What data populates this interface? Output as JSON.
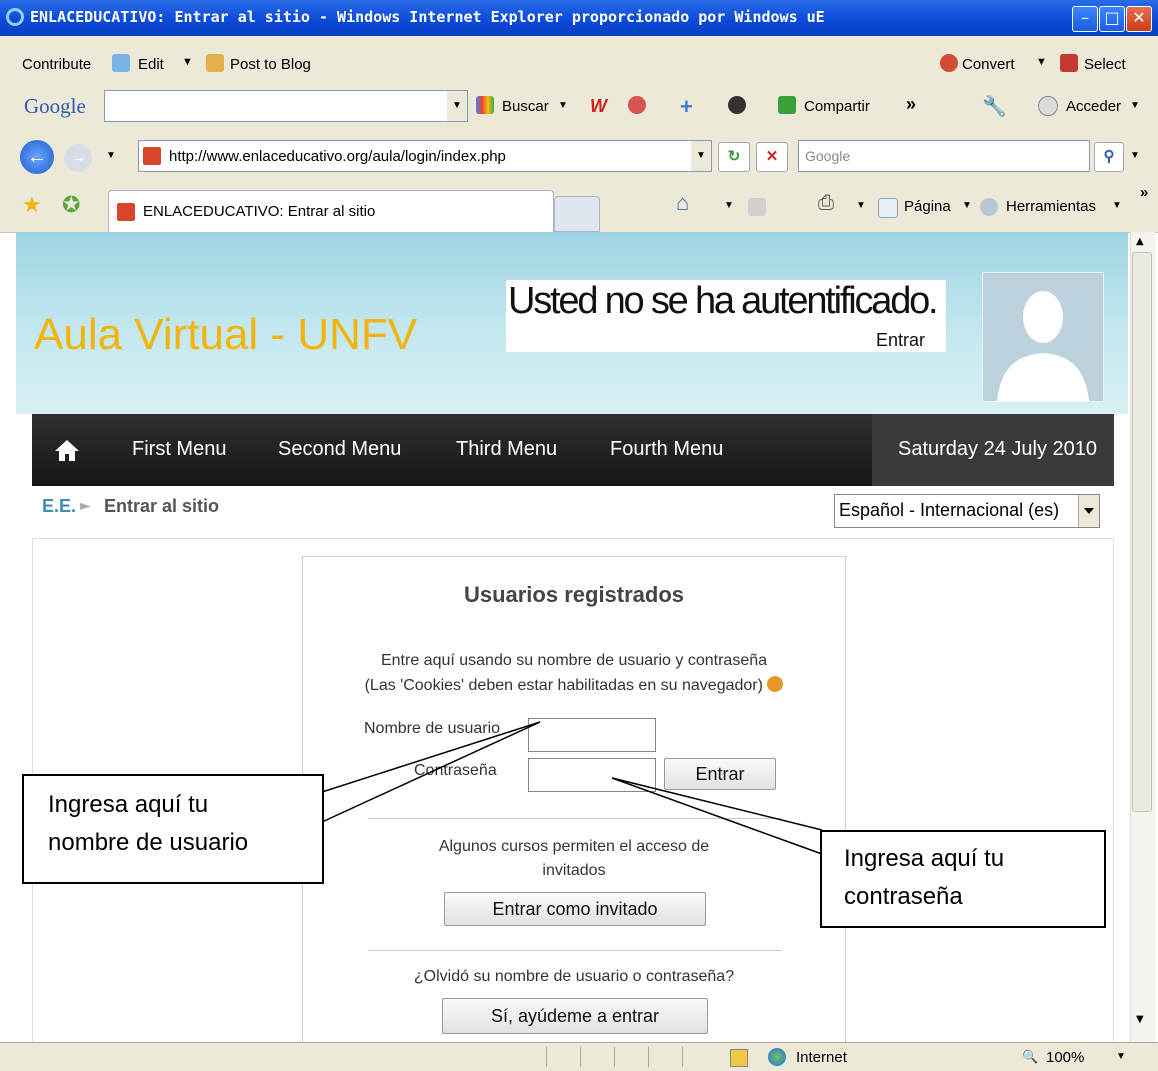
{
  "window": {
    "title": "ENLACEDUCATIVO: Entrar al sitio - Windows Internet Explorer proporcionado por Windows uE"
  },
  "contribute_bar": {
    "contribute": "Contribute",
    "edit": "Edit",
    "post_to_blog": "Post to Blog",
    "convert": "Convert",
    "select": "Select"
  },
  "google_bar": {
    "brand": "Google",
    "buscar": "Buscar",
    "compartir": "Compartir",
    "more": "»",
    "acceder": "Acceder"
  },
  "address_bar": {
    "url": "http://www.enlaceducativo.org/aula/login/index.php",
    "search_placeholder": "Google"
  },
  "tabs_bar": {
    "tab_title": "ENLACEDUCATIVO: Entrar al sitio",
    "pagina": "Página",
    "herramientas": "Herramientas",
    "more": "»"
  },
  "site": {
    "logo": "Aula Virtual - UNFV",
    "auth_message": "Usted no se ha autentificado.",
    "auth_link": "Entrar",
    "nav": [
      "First Menu",
      "Second Menu",
      "Third Menu",
      "Fourth Menu"
    ],
    "date": "Saturday 24 July 2010",
    "breadcrumb_home": "E.E.",
    "breadcrumb_sep": "►",
    "breadcrumb_current": "Entrar al sitio",
    "language": "Español - Internacional (es)"
  },
  "login": {
    "heading": "Usuarios registrados",
    "instructions_1": "Entre aquí usando su nombre de usuario y contraseña",
    "instructions_2": "(Las 'Cookies' deben estar habilitadas en su navegador)",
    "username_label": "Nombre de usuario",
    "password_label": "Contraseña",
    "submit": "Entrar",
    "guest_text_1": "Algunos cursos permiten el acceso de",
    "guest_text_2": "invitados",
    "guest_button": "Entrar como invitado",
    "forgot_text": "¿Olvidó su nombre de usuario o contraseña?",
    "forgot_button": "Sí, ayúdeme a entrar"
  },
  "callouts": {
    "username_1": "Ingresa aquí tu",
    "username_2": "nombre de usuario",
    "password_1": "Ingresa aquí tu",
    "password_2": "contraseña"
  },
  "status_bar": {
    "zone": "Internet",
    "zoom": "100%"
  }
}
